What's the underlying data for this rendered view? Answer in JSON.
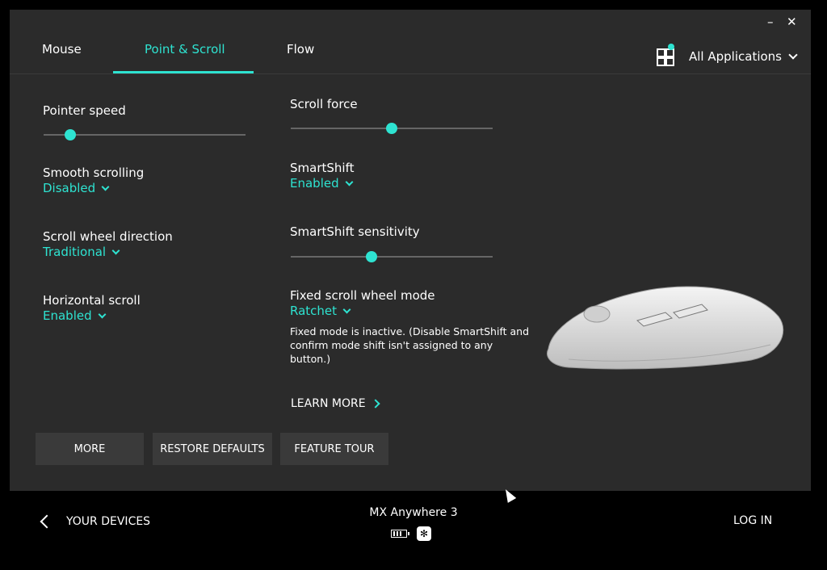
{
  "window": {
    "minimize": "–",
    "close": "✕"
  },
  "tabs": [
    {
      "label": "Mouse",
      "active": false
    },
    {
      "label": "Point & Scroll",
      "active": true
    },
    {
      "label": "Flow",
      "active": false
    }
  ],
  "app_switch": {
    "label": "All Applications",
    "icon": "apps-grid-icon"
  },
  "left": {
    "pointer_speed": {
      "title": "Pointer speed",
      "value": 0.13
    },
    "smooth_scrolling": {
      "title": "Smooth scrolling",
      "value": "Disabled"
    },
    "scroll_direction": {
      "title": "Scroll wheel direction",
      "value": "Traditional"
    },
    "horizontal_scroll": {
      "title": "Horizontal scroll",
      "value": "Enabled"
    }
  },
  "middle": {
    "scroll_force": {
      "title": "Scroll force",
      "value": 0.5
    },
    "smartshift": {
      "title": "SmartShift",
      "value": "Enabled"
    },
    "smartshift_sensitivity": {
      "title": "SmartShift sensitivity",
      "value": 0.4
    },
    "fixed_mode": {
      "title": "Fixed scroll wheel mode",
      "value": "Ratchet"
    },
    "note": "Fixed mode is inactive. (Disable SmartShift and confirm mode shift isn't assigned to any button.)",
    "learn_more": "LEARN MORE"
  },
  "buttons": {
    "more": "MORE",
    "restore": "RESTORE DEFAULTS",
    "tour": "FEATURE TOUR"
  },
  "footer": {
    "back": "YOUR DEVICES",
    "device_name": "MX Anywhere 3",
    "login": "LOG IN"
  },
  "colors": {
    "accent": "#2ee3d1",
    "panel": "#2b2b2b",
    "footer": "#000000"
  }
}
